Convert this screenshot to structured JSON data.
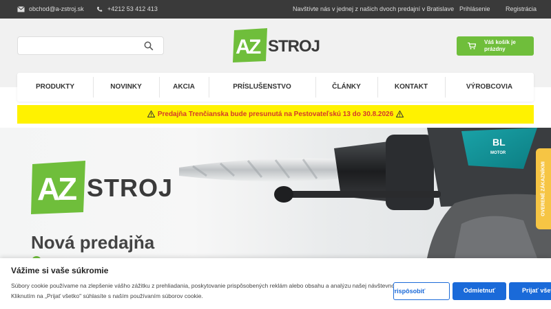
{
  "topbar": {
    "email": "obchod@a-zstroj.sk",
    "phone": "+4212 53 412 413",
    "visit": "Navštívte nás v jednej z našich dvoch predajní v Bratislave",
    "login": "Prihlásenie",
    "register": "Registrácia"
  },
  "search": {
    "placeholder": ""
  },
  "logo": {
    "a": "A",
    "z": "Z",
    "stroj": "STROJ"
  },
  "cart": {
    "line1": "Váš košík je",
    "line2": "prázdny"
  },
  "nav": [
    "PRODUKTY",
    "NOVINKY",
    "AKCIA",
    "PRÍSLUŠENSTVO",
    "ČLÁNKY",
    "KONTAKT",
    "VÝROBCOVIA"
  ],
  "alert": {
    "text": "Predajňa Trenčianska bude presunutá na Pestovateľskú 13 do 30.8.2026"
  },
  "hero": {
    "title": "Nová predajňa",
    "logo_a": "A",
    "logo_z": "Z",
    "logo_stroj": "STROJ",
    "tool_badge": "BL",
    "tool_badge2": "MOTOR"
  },
  "trust": {
    "label": "OVERENÉ ZÁKAZNÍKMI"
  },
  "cookie": {
    "title": "Vážime si vaše súkromie",
    "text": "Súbory cookie používame na zlepšenie vášho zážitku z prehliadania, poskytovanie prispôsobených reklám alebo obsahu a analýzu našej návštevnosti. Kliknutím na „Prijať všetko\" súhlasíte s naším používaním súborov cookie.",
    "customize": "Prispôsobiť",
    "reject": "Odmietnuť",
    "accept": "Prijať všetko"
  },
  "colors": {
    "green": "#6fbe3b",
    "yellow": "#fff200",
    "blue": "#1a6ad9",
    "topbar": "#3a3a3a"
  }
}
